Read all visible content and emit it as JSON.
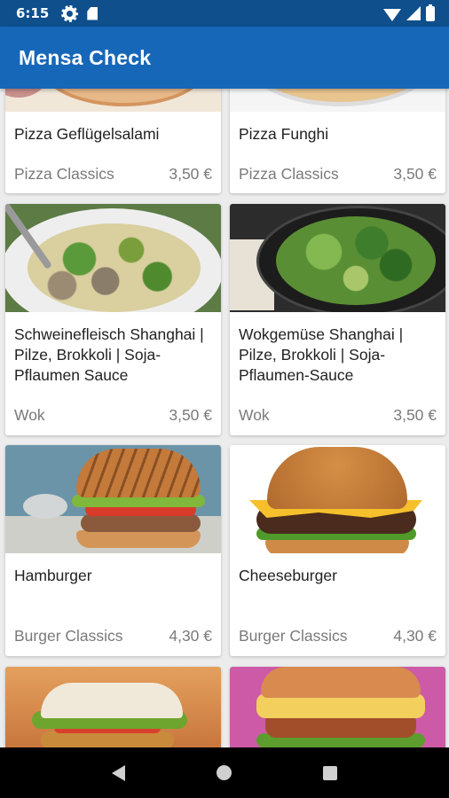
{
  "status_bar": {
    "time": "6:15",
    "icons": [
      "gear-icon",
      "sdcard-icon",
      "wifi-icon",
      "signal-icon",
      "battery-icon"
    ]
  },
  "app_bar": {
    "title": "Mensa Check",
    "color": "#1767b8"
  },
  "colors": {
    "status_bar": "#0e4f8c",
    "background": "#ececec",
    "card": "#ffffff",
    "text_primary": "#222222",
    "text_secondary": "#7a7a7a"
  },
  "menu_items": [
    {
      "name": "Pizza Geflügelsalami",
      "category": "Pizza Classics",
      "price": "3,50 €",
      "image": "pizza-image"
    },
    {
      "name": "Pizza Funghi",
      "category": "Pizza Classics",
      "price": "3,50 €",
      "image": "pizza-image"
    },
    {
      "name": "Schweinefleisch Shanghai | Pilze, Brokkoli | Soja-Pflaumen Sauce",
      "category": "Wok",
      "price": "3,50 €",
      "image": "wok-image"
    },
    {
      "name": "Wokgemüse Shanghai | Pilze, Brokkoli | Soja-Pflaumen-Sauce",
      "category": "Wok",
      "price": "3,50 €",
      "image": "wok-image"
    },
    {
      "name": "Hamburger",
      "category": "Burger Classics",
      "price": "4,30 €",
      "image": "burger-image"
    },
    {
      "name": "Cheeseburger",
      "category": "Burger Classics",
      "price": "4,30 €",
      "image": "burger-image"
    },
    {
      "name": "",
      "category": "",
      "price": "",
      "image": "burger-image"
    },
    {
      "name": "",
      "category": "",
      "price": "",
      "image": "burger-image"
    }
  ],
  "nav_bar": {
    "buttons": [
      "back-icon",
      "home-icon",
      "recents-icon"
    ]
  }
}
